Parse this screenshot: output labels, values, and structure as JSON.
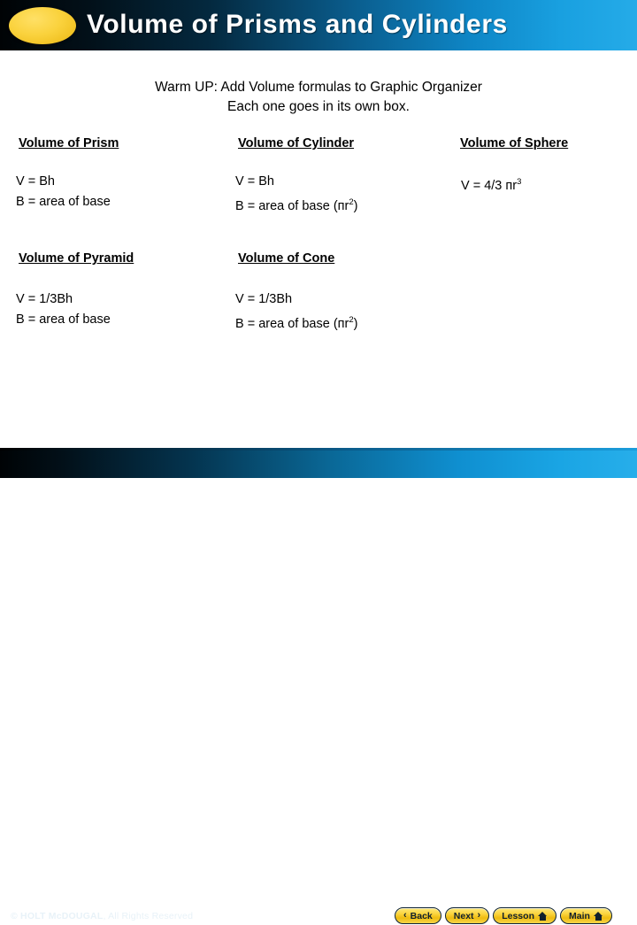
{
  "header": {
    "title": "Volume of Prisms and Cylinders",
    "logo_shape": "yellow-ellipse"
  },
  "warmup": {
    "line1": "Warm UP: Add Volume formulas to Graphic Organizer",
    "line2": "Each one goes in its own box."
  },
  "columns": {
    "prism": {
      "heading": "Volume of Prism",
      "line1": "V = Bh",
      "line2": "B = area of base"
    },
    "cylinder": {
      "heading": "Volume of Cylinder",
      "line1": "V = Bh",
      "line2_pre": "B = area of base (пr",
      "line2_sup": "2",
      "line2_post": ")"
    },
    "sphere": {
      "heading": "Volume of Sphere",
      "line1_pre": "V = 4/3 пr",
      "line1_sup": "3",
      "line1_post": ""
    },
    "pyramid": {
      "heading": "Volume of Pyramid",
      "line1": "V = 1/3Bh",
      "line2": "B = area of base"
    },
    "cone": {
      "heading": "Volume of Cone",
      "line1": "V = 1/3Bh",
      "line2_pre": "B = area of base (пr",
      "line2_sup": "2",
      "line2_post": ")"
    }
  },
  "footer": {
    "copyright_mark": "© HOLT McDOUGAL",
    "copyright_rest": ", All Rights Reserved",
    "buttons": [
      {
        "label": "Back",
        "icon": "chevron-left",
        "glyph": "‹"
      },
      {
        "label": "Next",
        "icon": "chevron-right",
        "glyph": "›"
      },
      {
        "label": "Lesson",
        "icon": "home"
      },
      {
        "label": "Main",
        "icon": "home"
      }
    ]
  },
  "colors": {
    "accent_blue": "#1aa5e4",
    "dark_navy": "#021019",
    "button_gold": "#fad43e",
    "logo_gold": "#fad23d",
    "text_black": "#000000"
  }
}
